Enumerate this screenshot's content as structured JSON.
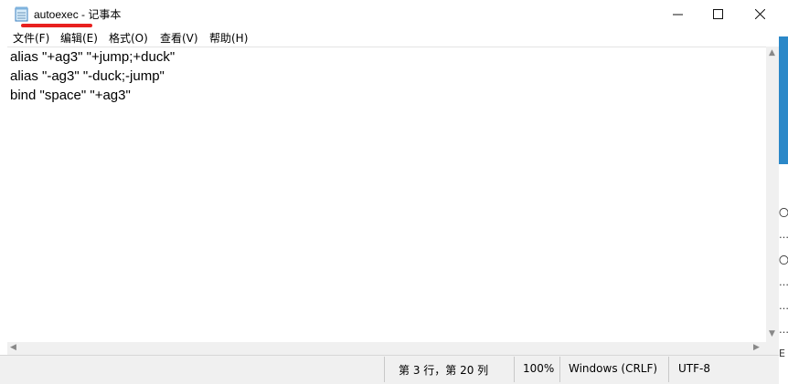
{
  "window": {
    "title": "autoexec - 记事本",
    "minimize_label": "—",
    "maximize_label": "☐",
    "close_label": "✕"
  },
  "menu": [
    "文件(F)",
    "编辑(E)",
    "格式(O)",
    "查看(V)",
    "帮助(H)"
  ],
  "editor": {
    "lines": [
      "alias \"+ag3\" \"+jump;+duck\"",
      "alias \"-ag3\" \"-duck;-jump\"",
      "bind \"space\" \"+ag3\""
    ]
  },
  "status": {
    "position": "第 3 行，第 20 列",
    "zoom": "100%",
    "line_ending": "Windows (CRLF)",
    "encoding": "UTF-8"
  },
  "colors": {
    "highlight_underline": "#e8201f",
    "background_accent": "#2b88c8"
  },
  "background_window_glyphs": [
    "〇",
    "…",
    "〇",
    "…",
    "…",
    "…",
    "E"
  ]
}
